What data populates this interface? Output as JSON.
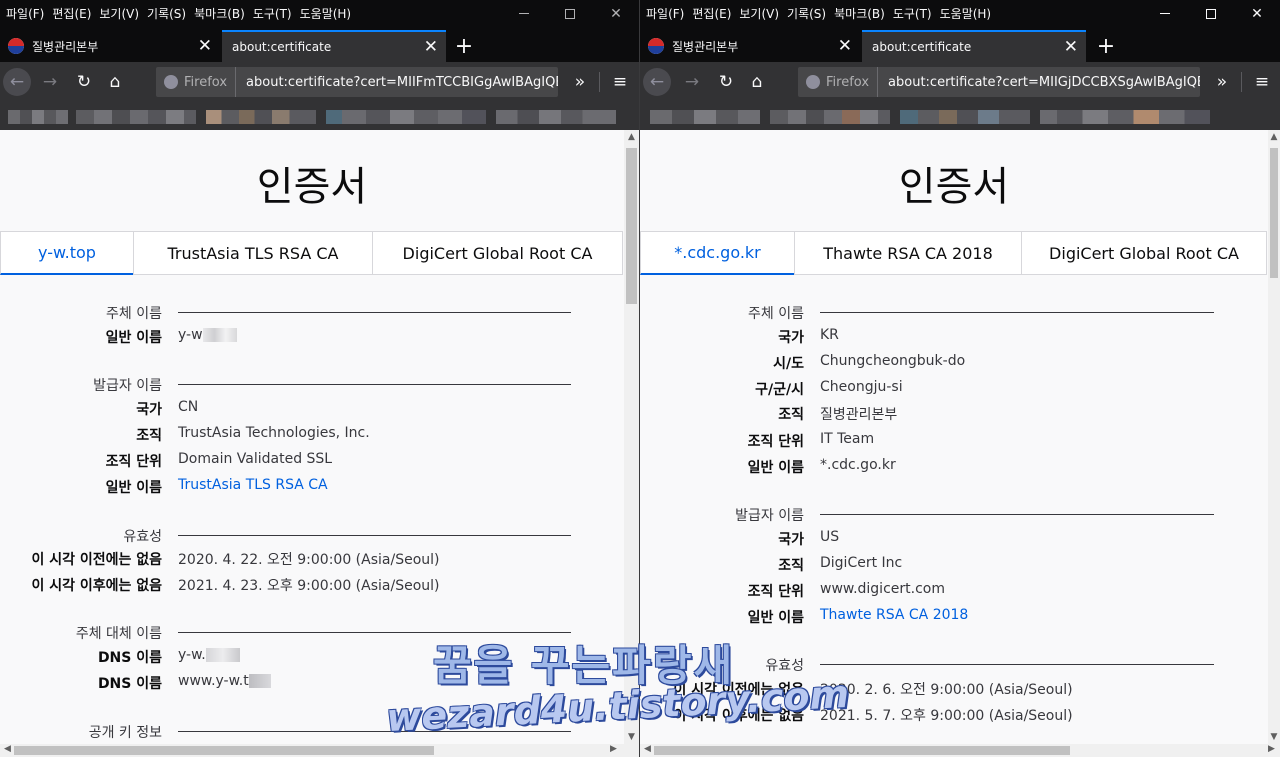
{
  "menu": [
    "파일(F)",
    "편집(E)",
    "보기(V)",
    "기록(S)",
    "북마크(B)",
    "도구(T)",
    "도움말(H)"
  ],
  "left": {
    "tabs": [
      {
        "title": "질병관리본부",
        "active": false
      },
      {
        "title": "about:certificate",
        "active": true
      }
    ],
    "identity": "Firefox",
    "url": "about:certificate?cert=MIIFmTCCBIGgAwIBAgIQBy",
    "page_title": "인증서",
    "cert_tabs": [
      "y-w.top",
      "TrustAsia TLS RSA CA",
      "DigiCert Global Root CA"
    ],
    "sections": {
      "subject": {
        "title": "주체 이름",
        "rows": [
          {
            "label": "일반 이름",
            "value": "y-w"
          }
        ]
      },
      "issuer": {
        "title": "발급자 이름",
        "rows": [
          {
            "label": "국가",
            "value": "CN"
          },
          {
            "label": "조직",
            "value": "TrustAsia Technologies, Inc."
          },
          {
            "label": "조직 단위",
            "value": "Domain Validated SSL"
          },
          {
            "label": "일반 이름",
            "value": "TrustAsia TLS RSA CA"
          }
        ]
      },
      "validity": {
        "title": "유효성",
        "rows": [
          {
            "label": "이 시각 이전에는 없음",
            "value": "2020. 4. 22. 오전 9:00:00 (Asia/Seoul)"
          },
          {
            "label": "이 시각 이후에는 없음",
            "value": "2021. 4. 23. 오후 9:00:00 (Asia/Seoul)"
          }
        ]
      },
      "san": {
        "title": "주체 대체 이름",
        "rows": [
          {
            "label": "DNS 이름",
            "value": "y-w."
          },
          {
            "label": "DNS 이름",
            "value": "www.y-w.t"
          }
        ]
      },
      "pubkey": {
        "title": "공개 키 정보"
      }
    }
  },
  "right": {
    "tabs": [
      {
        "title": "질병관리본부",
        "active": false
      },
      {
        "title": "about:certificate",
        "active": true
      }
    ],
    "identity": "Firefox",
    "url": "about:certificate?cert=MIIGjDCCBXSgAwIBAgIQBU",
    "page_title": "인증서",
    "cert_tabs": [
      "*.cdc.go.kr",
      "Thawte RSA CA 2018",
      "DigiCert Global Root CA"
    ],
    "sections": {
      "subject": {
        "title": "주체 이름",
        "rows": [
          {
            "label": "국가",
            "value": "KR"
          },
          {
            "label": "시/도",
            "value": "Chungcheongbuk-do"
          },
          {
            "label": "구/군/시",
            "value": "Cheongju-si"
          },
          {
            "label": "조직",
            "value": "질병관리본부"
          },
          {
            "label": "조직 단위",
            "value": "IT Team"
          },
          {
            "label": "일반 이름",
            "value": "*.cdc.go.kr"
          }
        ]
      },
      "issuer": {
        "title": "발급자 이름",
        "rows": [
          {
            "label": "국가",
            "value": "US"
          },
          {
            "label": "조직",
            "value": "DigiCert Inc"
          },
          {
            "label": "조직 단위",
            "value": "www.digicert.com"
          },
          {
            "label": "일반 이름",
            "value": "Thawte RSA CA 2018"
          }
        ]
      },
      "validity": {
        "title": "유효성",
        "rows": [
          {
            "label": "이 시각 이전에는 없음",
            "value": "2020. 2. 6. 오전 9:00:00 (Asia/Seoul)"
          },
          {
            "label": "이 시각 이후에는 없음",
            "value": "2021. 5. 7. 오후 9:00:00 (Asia/Seoul)"
          }
        ]
      }
    }
  },
  "watermark": {
    "line1": "꿈을 꾸는파랑새",
    "line2": "wezard4u.tistory.com"
  },
  "colors": {
    "accent": "#0a84ff",
    "link": "#0060df",
    "toolbar": "#323234",
    "chrome": "#0c0c0d",
    "page": "#f9f9fa"
  }
}
